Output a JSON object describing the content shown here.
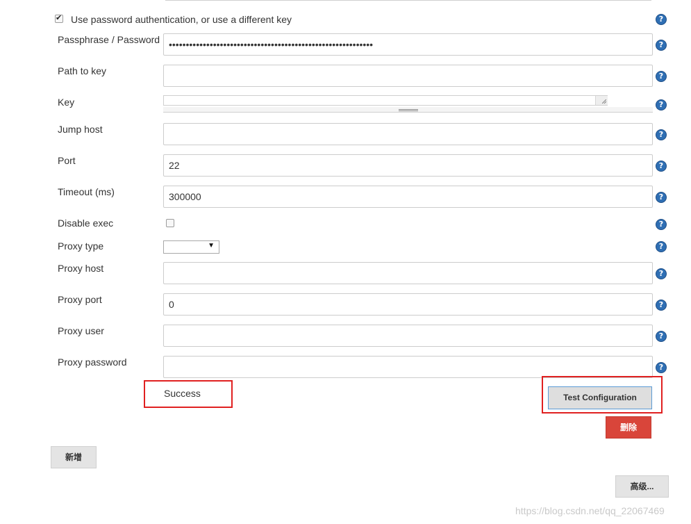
{
  "auth": {
    "checkbox_label": "Use password authentication, or use a different key",
    "checked": true
  },
  "fields": {
    "passphrase": {
      "label": "Passphrase / Password",
      "value": "••••••••••••••••••••••••••••••••••••••••••••••••••••••••••••"
    },
    "path_to_key": {
      "label": "Path to key",
      "value": ""
    },
    "key": {
      "label": "Key",
      "value": ""
    },
    "jump_host": {
      "label": "Jump host",
      "value": ""
    },
    "port": {
      "label": "Port",
      "value": "22"
    },
    "timeout": {
      "label": "Timeout (ms)",
      "value": "300000"
    },
    "disable_exec": {
      "label": "Disable exec",
      "checked": false
    },
    "proxy_type": {
      "label": "Proxy type",
      "value": ""
    },
    "proxy_host": {
      "label": "Proxy host",
      "value": ""
    },
    "proxy_port": {
      "label": "Proxy port",
      "value": "0"
    },
    "proxy_user": {
      "label": "Proxy user",
      "value": ""
    },
    "proxy_password": {
      "label": "Proxy password",
      "value": ""
    }
  },
  "help_glyph": "?",
  "status": {
    "text": "Success"
  },
  "buttons": {
    "test_configuration": "Test Configuration",
    "delete": "删除",
    "add": "新增",
    "advanced": "高级..."
  },
  "icons": {
    "help": "help-icon",
    "checkmark": "checkmark-icon",
    "dropdown": "chevron-down-icon",
    "resize": "resize-grip-icon"
  },
  "colors": {
    "help_icon": "#2f6fb4",
    "highlight_box": "#e02020",
    "delete_button": "#d9453a",
    "test_button_border": "#5b9bd5"
  },
  "watermark": "https://blog.csdn.net/qq_22067469"
}
